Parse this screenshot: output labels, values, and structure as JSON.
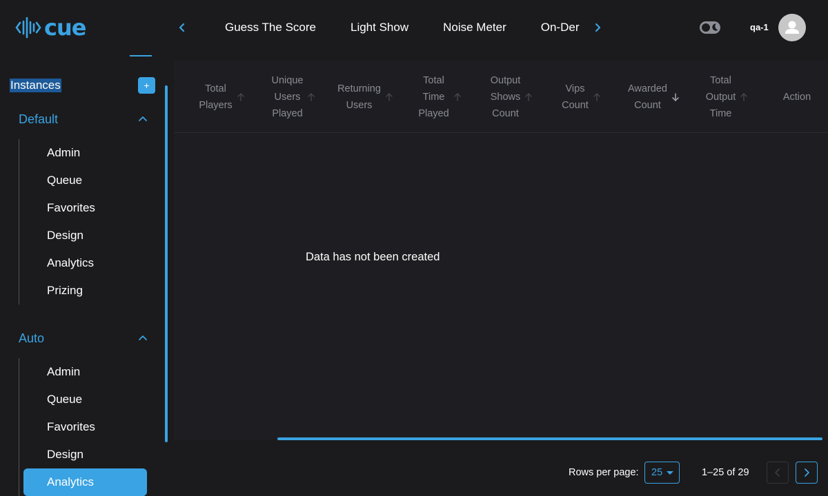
{
  "brand": {
    "name": "cue",
    "accent": "#3aa3e3"
  },
  "top_nav": {
    "tabs": [
      {
        "label": "Guess The Score"
      },
      {
        "label": "Light Show"
      },
      {
        "label": "Noise Meter"
      },
      {
        "label": "On-Der"
      }
    ],
    "prev_icon": "chevron-left-icon",
    "next_icon": "chevron-right-icon"
  },
  "header": {
    "user_name": "qa-1",
    "theme_toggle_icon": "moon-icon",
    "avatar_icon": "user-icon"
  },
  "sidebar": {
    "instances_label": "Instances",
    "add_label": "+",
    "groups": [
      {
        "label": "Default",
        "items": [
          "Admin",
          "Queue",
          "Favorites",
          "Design",
          "Analytics",
          "Prizing"
        ]
      },
      {
        "label": "Auto",
        "items": [
          "Admin",
          "Queue",
          "Favorites",
          "Design",
          "Analytics"
        ]
      }
    ],
    "active": {
      "group": "Auto",
      "item": "Analytics"
    }
  },
  "table": {
    "columns": [
      {
        "label": "Total\nPlayers",
        "sort": "up"
      },
      {
        "label": "Unique\nUsers\nPlayed",
        "sort": "up"
      },
      {
        "label": "Returning\nUsers",
        "sort": "up"
      },
      {
        "label": "Total\nTime\nPlayed",
        "sort": "up"
      },
      {
        "label": "Output\nShows\nCount",
        "sort": "up"
      },
      {
        "label": "Vips\nCount",
        "sort": "up"
      },
      {
        "label": "Awarded\nCount",
        "sort": "down-active"
      },
      {
        "label": "Total\nOutput\nTime",
        "sort": "up"
      },
      {
        "label": "Action",
        "sort": "none"
      }
    ],
    "empty_message": "Data has not been created"
  },
  "pagination": {
    "rows_per_page_label": "Rows per page:",
    "rows_per_page_value": "25",
    "range_text": "1–25 of 29"
  }
}
